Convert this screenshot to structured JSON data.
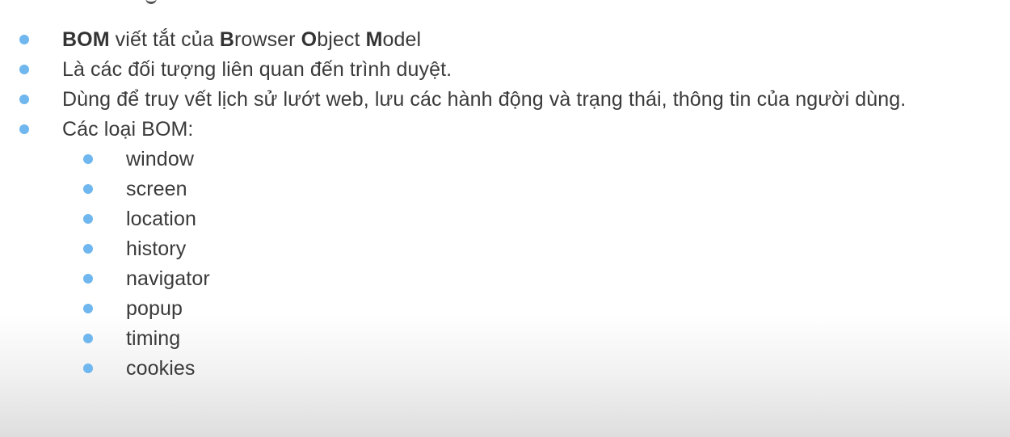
{
  "accent_color": "#6fb7ee",
  "intro": {
    "abbr_bold": "BOM",
    "abbr_text": " viết tắt của ",
    "b_letter": "B",
    "b_rest": "rowser ",
    "o_letter": "O",
    "o_rest": "bject ",
    "m_letter": "M",
    "m_rest": "odel"
  },
  "bullets": [
    "Là các đối tượng liên quan đến trình duyệt.",
    "Dùng để truy vết lịch sử lướt web, lưu các hành động và trạng thái, thông tin của người dùng.",
    "Các loại BOM:"
  ],
  "bom_types": [
    "window",
    "screen",
    "location",
    "history",
    "navigator",
    "popup",
    "timing",
    "cookies"
  ]
}
